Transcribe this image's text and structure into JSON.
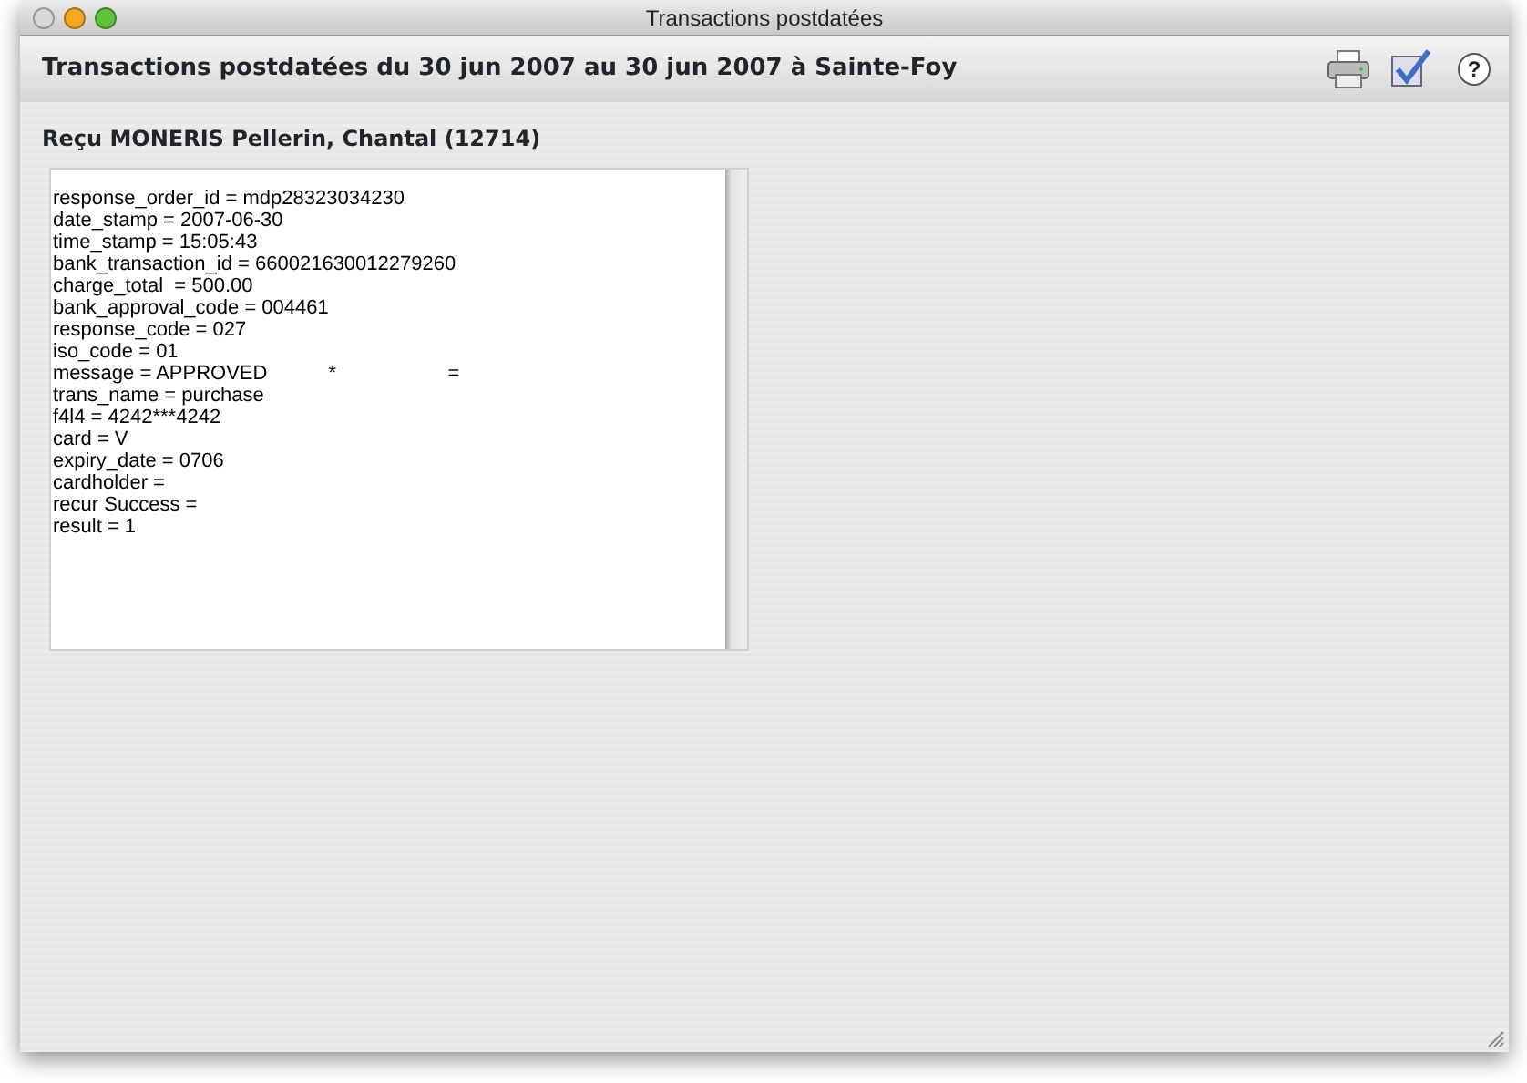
{
  "window": {
    "title": "Transactions postdatées"
  },
  "header": {
    "title": "Transactions postdatées du 30 jun 2007 au 30 jun 2007 à Sainte-Foy"
  },
  "toolbar": [
    {
      "kind": "print"
    },
    {
      "kind": "check"
    },
    {
      "kind": "help",
      "symbol": "?"
    }
  ],
  "receipt": {
    "title": "Reçu MONERIS Pellerin, Chantal (12714)",
    "lines": [
      "response_order_id = mdp28323034230",
      "date_stamp = 2007-06-30",
      "time_stamp = 15:05:43",
      "bank_transaction_id = 660021630012279260",
      "charge_total  = 500.00",
      "bank_approval_code = 004461",
      "response_code = 027",
      "iso_code = 01",
      "message = APPROVED           *                    =",
      "trans_name = purchase",
      "f4l4 = 4242***4242",
      "card = V",
      "expiry_date = 0706",
      "cardholder =",
      "recur Success =",
      "result = 1"
    ]
  }
}
